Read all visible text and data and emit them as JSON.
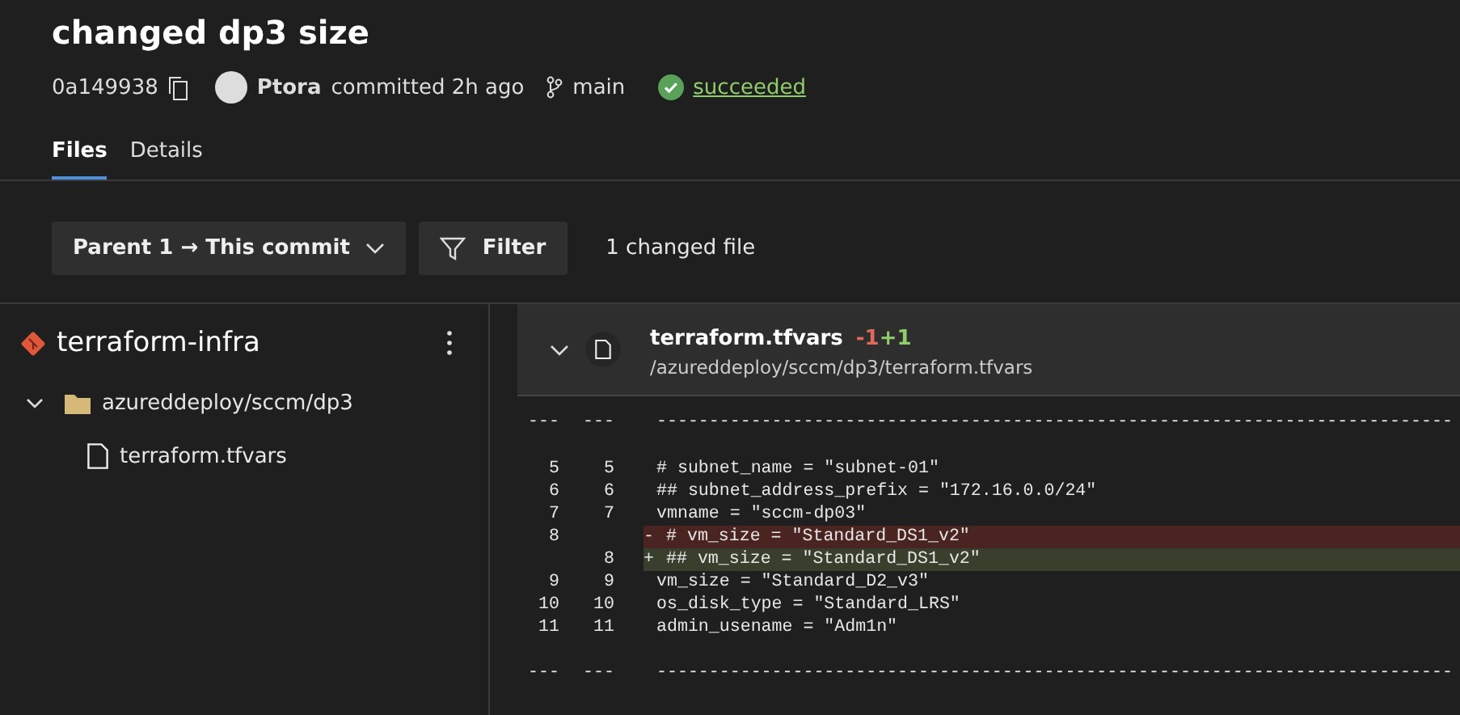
{
  "commit": {
    "title": "changed dp3 size",
    "hash": "0a149938",
    "author": "Ptora",
    "action": "committed 2h ago",
    "branch": "main",
    "status": "succeeded"
  },
  "tabs": [
    {
      "label": "Files",
      "selected": true
    },
    {
      "label": "Details",
      "selected": false
    }
  ],
  "toolbar": {
    "compare": "Parent 1 → This commit",
    "filter": "Filter",
    "summary": "1 changed file"
  },
  "tree": {
    "repo": "terraform-infra",
    "items": [
      {
        "label": "azureddeploy/sccm/dp3",
        "kind": "folder",
        "expanded": true,
        "children": [
          {
            "label": "terraform.tfvars",
            "kind": "file"
          }
        ]
      }
    ]
  },
  "file": {
    "name": "terraform.tfvars",
    "removed": "-1",
    "added": "+1",
    "path": "/azureddeploy/sccm/dp3/terraform.tfvars",
    "expanded": true
  },
  "diff": [
    {
      "kind": "separator",
      "old": "---",
      "new": "---",
      "text": "----------------------------------------------------------------------------"
    },
    {
      "kind": "context",
      "old": "5",
      "new": "5",
      "text": "# subnet_name = \"subnet-01\""
    },
    {
      "kind": "context",
      "old": "6",
      "new": "6",
      "text": "## subnet_address_prefix = \"172.16.0.0/24\""
    },
    {
      "kind": "context",
      "old": "7",
      "new": "7",
      "text": "vmname = \"sccm-dp03\""
    },
    {
      "kind": "removed",
      "old": "8",
      "sign": "-",
      "text": "# vm_size = \"Standard_DS1_v2\""
    },
    {
      "kind": "added",
      "new": "8",
      "sign": "+",
      "text": "## vm_size = \"Standard_DS1_v2\""
    },
    {
      "kind": "context",
      "old": "9",
      "new": "9",
      "text": "vm_size = \"Standard_D2_v3\""
    },
    {
      "kind": "context",
      "old": "10",
      "new": "10",
      "text": "os_disk_type = \"Standard_LRS\""
    },
    {
      "kind": "context",
      "old": "11",
      "new": "11",
      "text": "admin_usename = \"Adm1n\""
    },
    {
      "kind": "separator",
      "old": "---",
      "new": "---",
      "text": "----------------------------------------------------------------------------"
    }
  ]
}
